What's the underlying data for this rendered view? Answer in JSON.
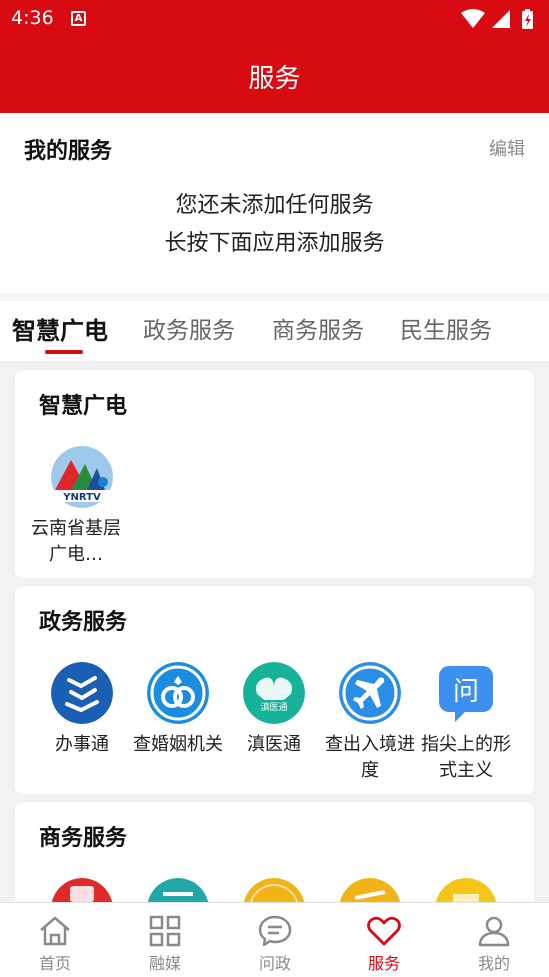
{
  "status_bar": {
    "time": "4:36",
    "notification_glyph": "A"
  },
  "header": {
    "title": "服务"
  },
  "my_services": {
    "title": "我的服务",
    "edit_label": "编辑",
    "empty_line1": "您还未添加任何服务",
    "empty_line2": "长按下面应用添加服务"
  },
  "tabs": [
    {
      "label": "智慧广电",
      "active": true
    },
    {
      "label": "政务服务",
      "active": false
    },
    {
      "label": "商务服务",
      "active": false
    },
    {
      "label": "民生服务",
      "active": false
    }
  ],
  "sections": [
    {
      "title": "智慧广电",
      "items": [
        {
          "label": "云南省基层广电…",
          "icon": "ynrtv-logo-icon",
          "logo_text": "YNRTV"
        }
      ]
    },
    {
      "title": "政务服务",
      "items": [
        {
          "label": "办事通",
          "icon": "banshitong-icon"
        },
        {
          "label": "查婚姻机关",
          "icon": "marriage-rings-icon"
        },
        {
          "label": "滇医通",
          "icon": "dianyitong-icon",
          "logo_text": "滇医通"
        },
        {
          "label": "查出入境进度",
          "icon": "airplane-icon"
        },
        {
          "label": "指尖上的形式主义",
          "icon": "question-chat-icon",
          "logo_text": "问"
        }
      ]
    },
    {
      "title": "商务服务",
      "items": [
        {
          "label": "",
          "icon": "red-app-icon"
        },
        {
          "label": "",
          "icon": "teal-app-icon"
        },
        {
          "label": "",
          "icon": "yellow-app-icon"
        },
        {
          "label": "",
          "icon": "yellow-app-icon"
        },
        {
          "label": "",
          "icon": "yellow-app-icon"
        }
      ]
    }
  ],
  "bottom_nav": [
    {
      "label": "首页",
      "icon": "home-icon",
      "active": false
    },
    {
      "label": "融媒",
      "icon": "grid-icon",
      "active": false
    },
    {
      "label": "问政",
      "icon": "chat-bubble-icon",
      "active": false
    },
    {
      "label": "服务",
      "icon": "heart-icon",
      "active": true
    },
    {
      "label": "我的",
      "icon": "person-icon",
      "active": false
    }
  ],
  "colors": {
    "brand_red": "#d80a12",
    "banshitong_blue": "#1a5fb4",
    "marriage_blue": "#1a8de0",
    "dianyitong_teal": "#16b39a",
    "airplane_blue": "#2a8ee6",
    "question_blue": "#3d8ff0"
  }
}
